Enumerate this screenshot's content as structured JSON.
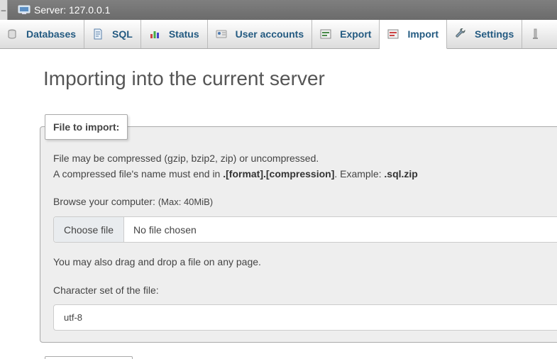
{
  "serverbar": {
    "collapse_glyph": "–",
    "title": "Server: 127.0.0.1",
    "icon": "server-icon"
  },
  "tabs": [
    {
      "label": "Databases",
      "icon": "database-icon"
    },
    {
      "label": "SQL",
      "icon": "sql-icon"
    },
    {
      "label": "Status",
      "icon": "status-icon"
    },
    {
      "label": "User accounts",
      "icon": "user-accounts-icon"
    },
    {
      "label": "Export",
      "icon": "export-icon"
    },
    {
      "label": "Import",
      "icon": "import-icon",
      "active": true
    },
    {
      "label": "Settings",
      "icon": "settings-icon"
    },
    {
      "label": "",
      "icon": "more-icon"
    }
  ],
  "main": {
    "heading": "Importing into the current server",
    "file_section": {
      "legend": "File to import:",
      "compression_line1": "File may be compressed (gzip, bzip2, zip) or uncompressed.",
      "compression_line2_prefix": "A compressed file's name must end in ",
      "compression_line2_format": ".[format].[compression]",
      "compression_line2_mid": ". Example: ",
      "compression_line2_example": ".sql.zip",
      "browse_label": "Browse your computer: ",
      "browse_max": "(Max: 40MiB)",
      "choose_file_button": "Choose file",
      "no_file_text": "No file chosen",
      "drag_drop_text": "You may also drag and drop a file on any page.",
      "charset_label": "Character set of the file:",
      "charset_value": "utf-8"
    }
  },
  "colors": {
    "tab_text": "#235a81",
    "fieldset_bg": "#eeeeee",
    "serverbar_bg": "#707070"
  }
}
